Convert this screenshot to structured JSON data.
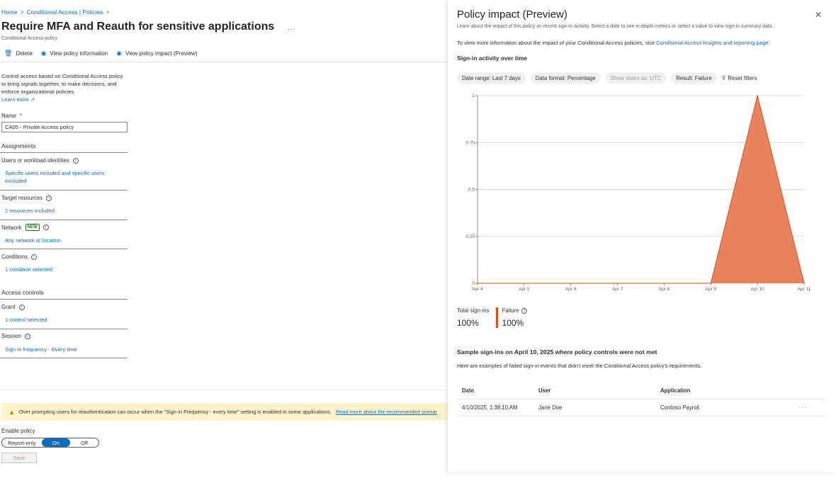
{
  "breadcrumb": {
    "home": "Home",
    "sep": ">",
    "policies": "Conditional Access | Policies"
  },
  "page": {
    "title": "Require MFA and Reauth for sensitive applications",
    "more": "...",
    "subtitle": "Conditional Access policy"
  },
  "toolbar": {
    "delete": "Delete",
    "view_info": "View policy information",
    "view_impact": "View policy impact (Preview)"
  },
  "intro": {
    "text": "Control access based on Conditional Access policy to bring signals together, to make decisions, and enforce organizational policies.",
    "learn_more": "Learn more"
  },
  "name": {
    "label": "Name",
    "required": "*",
    "value": "CA05 - Private Access policy"
  },
  "assignments": {
    "heading": "Assignments",
    "users_label": "Users or workload identities",
    "users_value": "Specific users included and specific users excluded",
    "resources_label": "Target resources",
    "resources_value": "2 resources included",
    "network_label": "Network",
    "network_badge": "NEW",
    "network_value": "Any network or location",
    "conditions_label": "Conditions",
    "conditions_value": "1 condition selected"
  },
  "access_controls": {
    "heading": "Access controls",
    "grant_label": "Grant",
    "grant_value": "1 control selected",
    "session_label": "Session",
    "session_value": "Sign-in frequency - Every time"
  },
  "warning": {
    "text": "Over prompting users for reauthentication can occur when the \"Sign-in Frequency - every time\" setting is enabled in some applications.",
    "link": "Read more about the recommended scenar"
  },
  "enable_policy": {
    "label": "Enable policy",
    "options": [
      "Report-only",
      "On",
      "Off"
    ],
    "selected": "On",
    "save": "Save"
  },
  "panel": {
    "title": "Policy impact (Preview)",
    "close": "✕",
    "description": "Learn about the impact of this policy on recent sign-in activity. Select a date to see in-depth metrics or select a value to view sign-in summary data.",
    "more_info_prefix": "To view more information about the impact of your Conditional Access policies, visit",
    "more_info_link": "Conditional Access Insights and reporting page.",
    "section": "Sign-in activity over time",
    "filters": {
      "date_range": "Date range: Last 7 days",
      "data_format": "Data format: Percentage",
      "show_dates": "Show dates as: UTC",
      "result": "Result: Failure",
      "reset": "Reset filters"
    },
    "totals": {
      "total_label": "Total sign-ins",
      "total_value": "100%",
      "failure_label": "Failure",
      "failure_value": "100%"
    },
    "sample": {
      "heading": "Sample sign-ins on April 10, 2025 where policy controls were not met",
      "description": "Here are examples of failed sign-in events that didn't meet the Conditional Access policy's requirements.",
      "columns": [
        "Date",
        "User",
        "Application"
      ],
      "rows": [
        {
          "date": "4/10/2025, 1:38:10 AM",
          "user": "Jane Doe",
          "application": "Contoso Payroll",
          "more": "···"
        }
      ]
    }
  },
  "colors": {
    "accent": "#0f6cbd",
    "failure": "#e8825f",
    "failure_stroke": "#e04b1a"
  },
  "chart_data": {
    "type": "area",
    "x": [
      "Apr 4",
      "Apr 5",
      "Apr 6",
      "Apr 7",
      "Apr 8",
      "Apr 9",
      "Apr 10",
      "Apr 11"
    ],
    "series": [
      {
        "name": "Failure",
        "values": [
          0,
          0,
          0,
          0,
          0,
          0,
          1,
          0
        ]
      }
    ],
    "yticks": [
      "0",
      "0.25",
      "0.5",
      "0.75",
      "1"
    ],
    "ylim": [
      0,
      1
    ],
    "grid": true,
    "legend": "none"
  }
}
